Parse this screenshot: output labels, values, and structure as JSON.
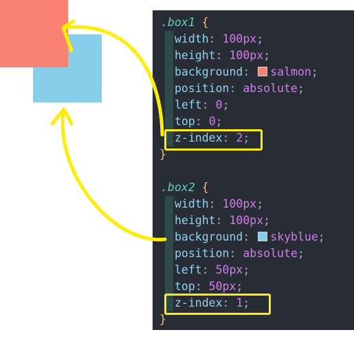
{
  "preview": {
    "box1_color": "#fa8072",
    "box2_color": "#87ceeb"
  },
  "code": {
    "box1": {
      "selector": ".box1",
      "open": "{",
      "close": "}",
      "lines": [
        {
          "prop": "width",
          "value": "100",
          "unit": "px"
        },
        {
          "prop": "height",
          "value": "100",
          "unit": "px"
        },
        {
          "prop": "background",
          "value": "salmon",
          "swatch": "#fa8072"
        },
        {
          "prop": "position",
          "value": "absolute"
        },
        {
          "prop": "left",
          "value": "0"
        },
        {
          "prop": "top",
          "value": "0"
        },
        {
          "prop": "z-index",
          "value": "2"
        }
      ]
    },
    "box2": {
      "selector": ".box2",
      "open": "{",
      "close": "}",
      "lines": [
        {
          "prop": "width",
          "value": "100",
          "unit": "px"
        },
        {
          "prop": "height",
          "value": "100",
          "unit": "px"
        },
        {
          "prop": "background",
          "value": "skyblue",
          "swatch": "#87ceeb"
        },
        {
          "prop": "position",
          "value": "absolute"
        },
        {
          "prop": "left",
          "value": "50",
          "unit": "px"
        },
        {
          "prop": "top",
          "value": "50",
          "unit": "px"
        },
        {
          "prop": "z-index",
          "value": "1"
        }
      ]
    }
  },
  "annotation_color": "#ffee00"
}
